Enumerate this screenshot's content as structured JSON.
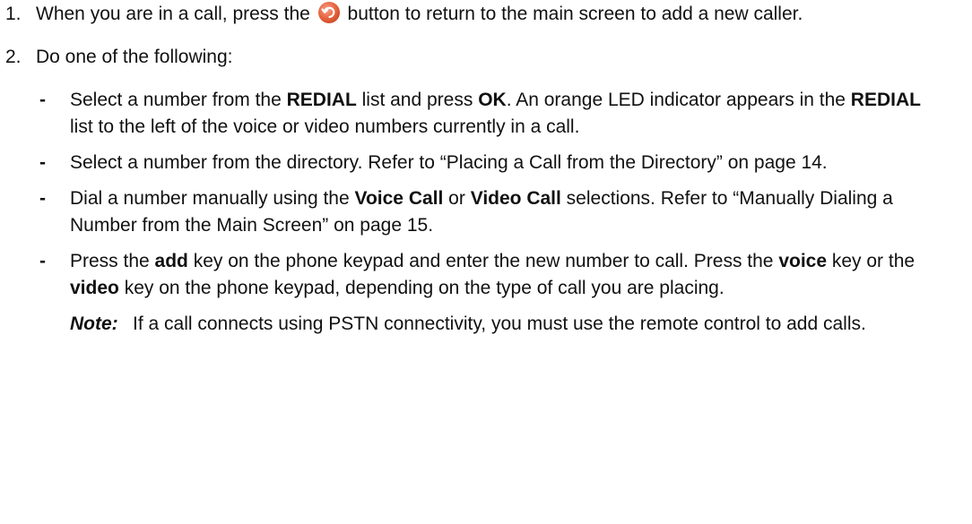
{
  "step1": {
    "num": "1.",
    "before": "When you are in a call, press the",
    "icon": "back-arrow-icon",
    "icon_color": "#E8643F",
    "after": "button to return to the main screen to add a new caller."
  },
  "step2": {
    "num": "2.",
    "text": "Do one of the following:"
  },
  "subitems": {
    "dash": "-",
    "i1": {
      "t1": "Select a number from the ",
      "b1": "REDIAL",
      "t2": " list and press ",
      "b2": "OK",
      "t3": ". An orange LED indicator appears in the ",
      "b3": "REDIAL",
      "t4": " list to the left of the voice or video numbers currently in a call."
    },
    "i2": {
      "t1": "Select a number from the directory. Refer to “Placing a Call from the Directory” on page 14."
    },
    "i3": {
      "t1": "Dial a number manually using the ",
      "b1": "Voice Call",
      "t2": " or ",
      "b2": "Video Call",
      "t3": " selections. Refer to “Manually Dialing a Number from the Main Screen” on page 15."
    },
    "i4": {
      "t1": "Press the ",
      "b1": "add",
      "t2": " key on the phone keypad and enter the new number to call. Press the ",
      "b2": "voice",
      "t3": " key or the ",
      "b3": "video",
      "t4": " key on the phone keypad, depending on the type of call you are placing."
    }
  },
  "note": {
    "label": "Note:",
    "text": "If a call connects using PSTN connectivity, you must use the remote control to add calls."
  }
}
